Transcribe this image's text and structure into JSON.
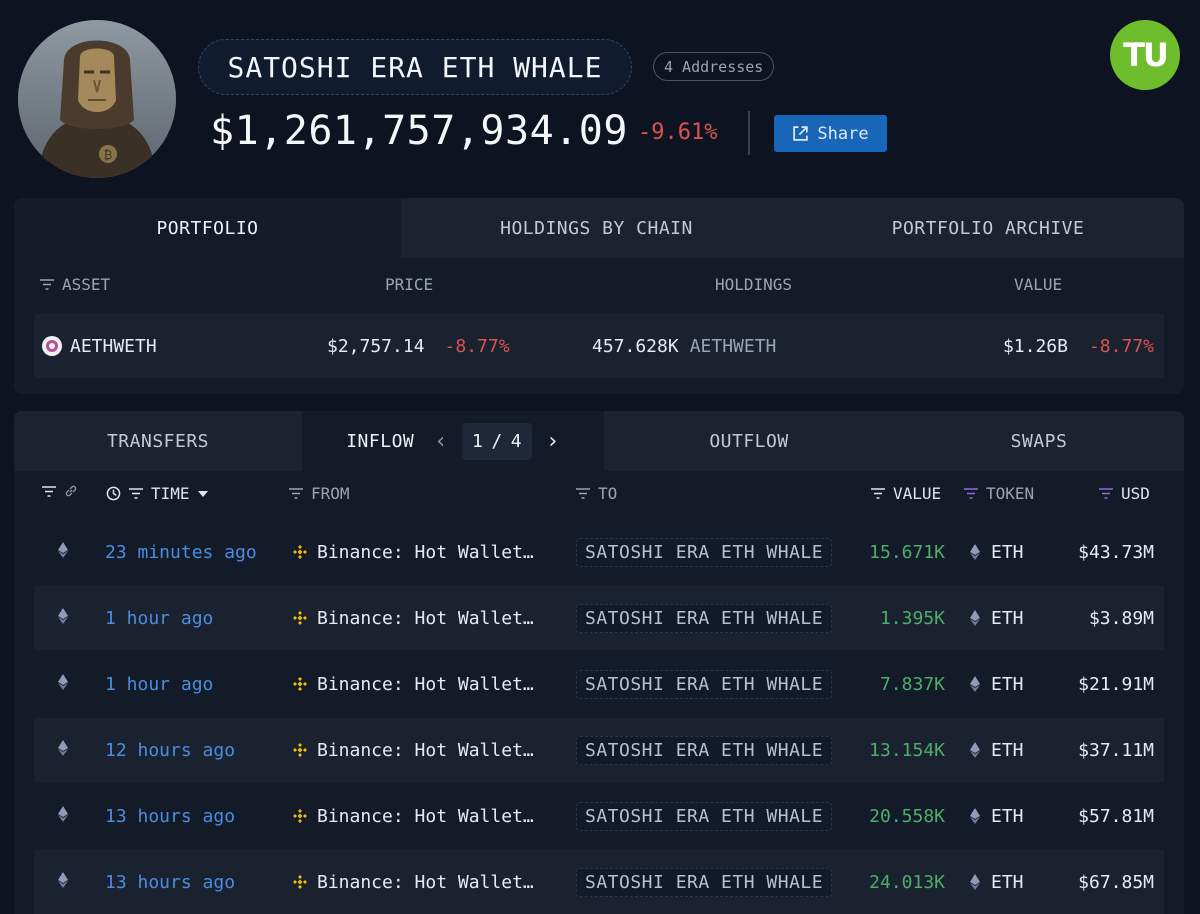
{
  "header": {
    "entity_name": "SATOSHI ERA ETH WHALE",
    "address_count": "4 Addresses",
    "balance": "$1,261,757,934.09",
    "balance_change": "-9.61%",
    "share_label": "Share",
    "logo_text": "TU"
  },
  "portfolio_panel": {
    "tabs": [
      {
        "label": "PORTFOLIO",
        "active": true
      },
      {
        "label": "HOLDINGS BY CHAIN",
        "active": false
      },
      {
        "label": "PORTFOLIO ARCHIVE",
        "active": false
      }
    ],
    "columns": {
      "asset": "ASSET",
      "price": "PRICE",
      "holdings": "HOLDINGS",
      "value": "VALUE"
    },
    "rows": [
      {
        "asset": "AETHWETH",
        "price": "$2,757.14",
        "price_change": "-8.77%",
        "holdings_amount": "457.628K",
        "holdings_symbol": "AETHWETH",
        "value": "$1.26B",
        "value_change": "-8.77%"
      }
    ]
  },
  "transfers_panel": {
    "tabs": [
      {
        "label": "TRANSFERS",
        "active": false
      },
      {
        "label": "INFLOW",
        "active": true
      },
      {
        "label": "OUTFLOW",
        "active": false
      },
      {
        "label": "SWAPS",
        "active": false
      }
    ],
    "pager": {
      "current": "1",
      "separator": "/",
      "total": "4"
    },
    "columns": {
      "time": "TIME",
      "from": "FROM",
      "to": "TO",
      "value": "VALUE",
      "token": "TOKEN",
      "usd": "USD"
    },
    "rows": [
      {
        "time": "23 minutes ago",
        "from": "Binance: Hot Wallet…",
        "to": "SATOSHI ERA ETH WHALE",
        "value": "15.671K",
        "token": "ETH",
        "usd": "$43.73M"
      },
      {
        "time": "1 hour ago",
        "from": "Binance: Hot Wallet…",
        "to": "SATOSHI ERA ETH WHALE",
        "value": "1.395K",
        "token": "ETH",
        "usd": "$3.89M"
      },
      {
        "time": "1 hour ago",
        "from": "Binance: Hot Wallet…",
        "to": "SATOSHI ERA ETH WHALE",
        "value": "7.837K",
        "token": "ETH",
        "usd": "$21.91M"
      },
      {
        "time": "12 hours ago",
        "from": "Binance: Hot Wallet…",
        "to": "SATOSHI ERA ETH WHALE",
        "value": "13.154K",
        "token": "ETH",
        "usd": "$37.11M"
      },
      {
        "time": "13 hours ago",
        "from": "Binance: Hot Wallet…",
        "to": "SATOSHI ERA ETH WHALE",
        "value": "20.558K",
        "token": "ETH",
        "usd": "$57.81M"
      },
      {
        "time": "13 hours ago",
        "from": "Binance: Hot Wallet…",
        "to": "SATOSHI ERA ETH WHALE",
        "value": "24.013K",
        "token": "ETH",
        "usd": "$67.85M"
      }
    ]
  },
  "colors": {
    "background": "#0d1320",
    "negative": "#d9534f",
    "positive": "#4cae6a",
    "link": "#4a8de0",
    "share_button": "#1766b7",
    "logo": "#6ebd2c"
  },
  "icons": [
    "avatar-statue",
    "external-link-icon",
    "filter-icon",
    "link-icon",
    "clock-icon",
    "caret-down-icon",
    "ethereum-icon",
    "binance-icon",
    "aave-icon",
    "chevron-left-icon",
    "chevron-right-icon"
  ]
}
